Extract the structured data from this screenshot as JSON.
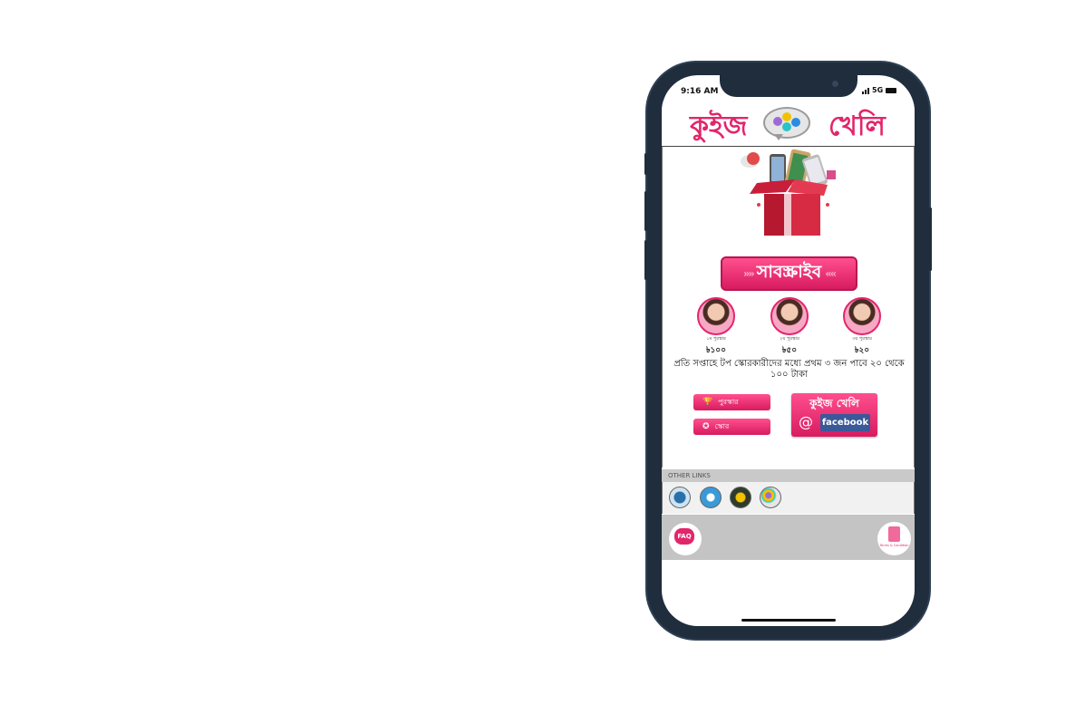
{
  "status": {
    "time": "9:16 AM",
    "network": "5G"
  },
  "header": {
    "title_left": "কুইজ",
    "title_right": "খেলি",
    "logo_icon": "quiz-bubble-icon"
  },
  "hero": {
    "icon": "gift-box-phones-icon"
  },
  "subscribe": {
    "label": "সাবস্ক্রাইব"
  },
  "winners": [
    {
      "rank": "১ম পুরস্কার",
      "amount": "৳১০০"
    },
    {
      "rank": "২য় পুরস্কার",
      "amount": "৳৫০"
    },
    {
      "rank": "৩য় পুরস্কার",
      "amount": "৳২০"
    }
  ],
  "info_text": "প্রতি সপ্তাহে টপ স্কোরকারীদের মধ্যে প্রথম ৩ জন পাবে ২০ থেকে ১০০ টাকা",
  "actions": {
    "prize_label": "পুরস্কার",
    "score_label": "স্কোর",
    "fb_title": "কুইজ খেলি",
    "fb_at": "@",
    "fb_logo": "facebook"
  },
  "other_links": {
    "label": "OTHER LINKS",
    "icons": [
      "video-app-icon",
      "fitness-app-icon",
      "game-app-icon",
      "quiz-app-icon"
    ]
  },
  "footer": {
    "faq_label": "FAQ",
    "terms_label": "Terms & Condition"
  },
  "colors": {
    "accent": "#e3256b",
    "facebook": "#3b5998",
    "bezel": "#1f2d3d"
  }
}
